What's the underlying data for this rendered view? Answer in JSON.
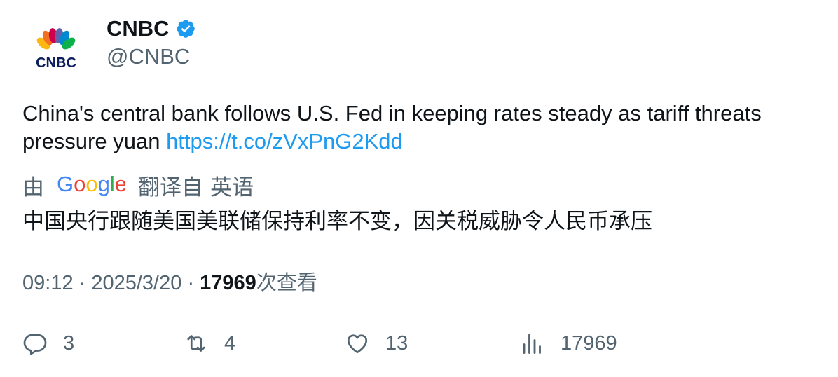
{
  "author": {
    "display_name": "CNBC",
    "handle": "@CNBC",
    "verified": true,
    "avatar_text": "CNBC",
    "avatar_icon": "peacock-logo"
  },
  "tweet": {
    "text": "China's central bank follows U.S. Fed in keeping rates steady as tariff threats pressure yuan ",
    "link": "https://t.co/zVxPnG2Kdd"
  },
  "translation": {
    "prefix": "由",
    "provider_logo": "Google",
    "from_label": "翻译自",
    "language": "英语",
    "text": "中国央行跟随美国美联储保持利率不变，因关税威胁令人民币承压"
  },
  "meta": {
    "time": "09:12",
    "separator": "·",
    "date": "2025/3/20",
    "views_count": "17969",
    "views_label": "次查看"
  },
  "actions": {
    "replies": "3",
    "retweets": "4",
    "likes": "13",
    "views": "17969"
  },
  "colors": {
    "link": "#1d9bf0",
    "secondary_text": "#536471",
    "primary_text": "#0f1419",
    "verified": "#1d9bf0"
  }
}
